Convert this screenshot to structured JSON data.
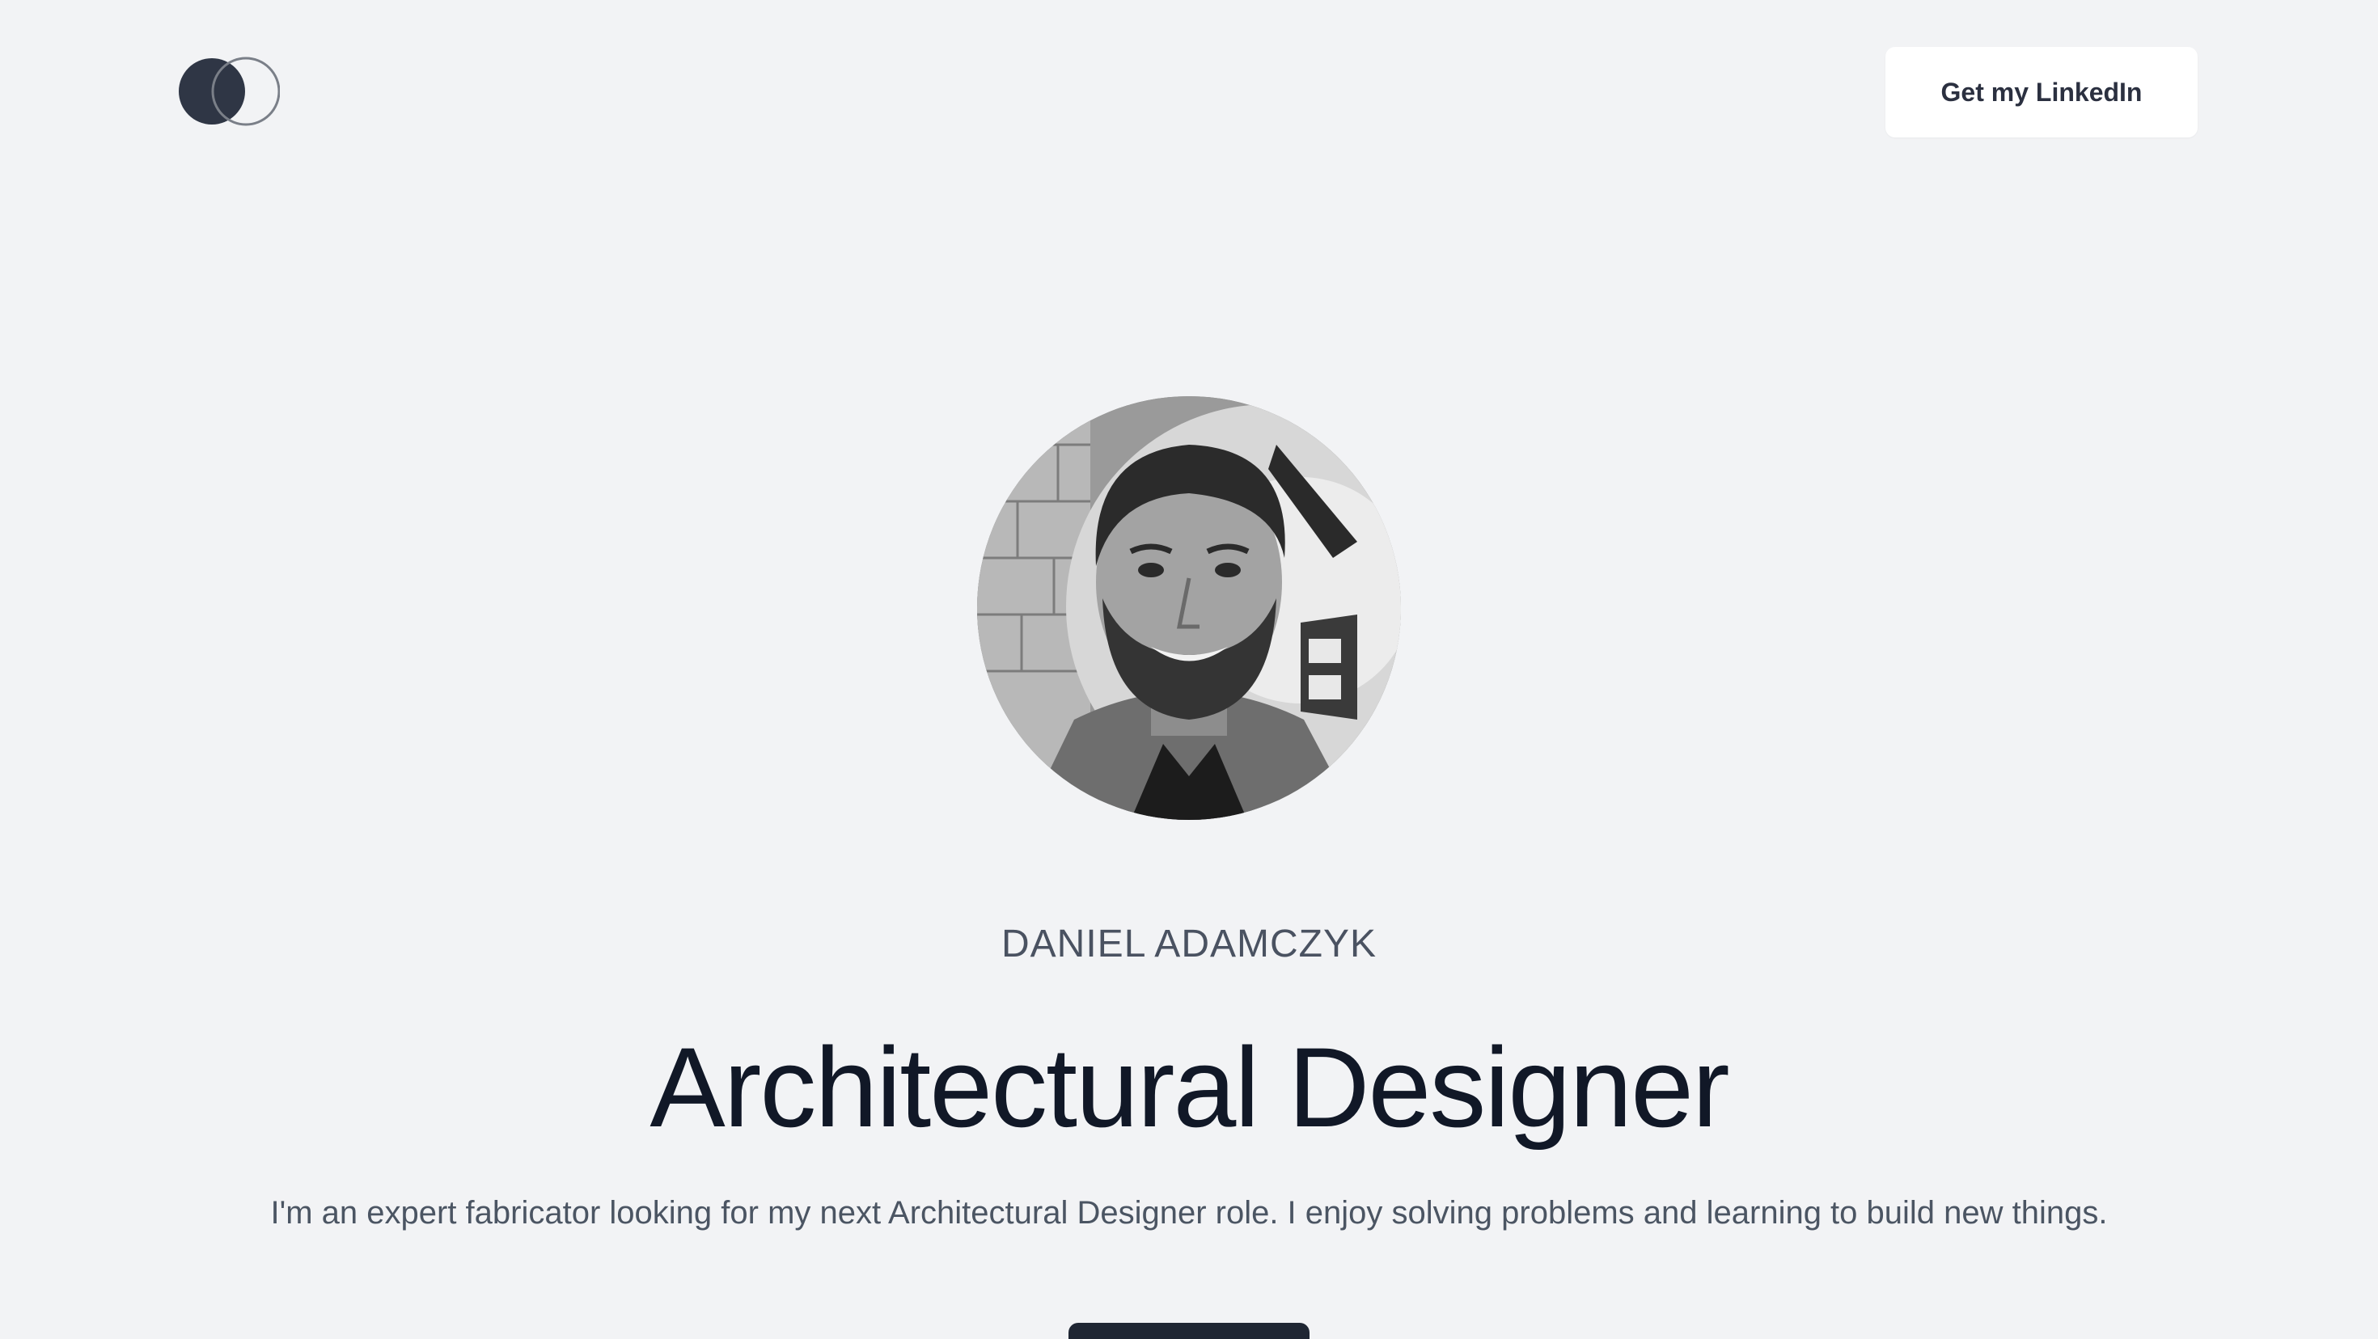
{
  "header": {
    "logo_icon": "overlapping-circles-logo",
    "linkedin_button_label": "Get my LinkedIn"
  },
  "hero": {
    "avatar_icon": "profile-photo",
    "name": "DANIEL ADAMCZYK",
    "title": "Architectural Designer",
    "description": "I'm an expert fabricator looking for my next Architectural Designer role. I enjoy solving problems and learning to build new things."
  },
  "colors": {
    "background": "#f2f3f5",
    "title_text": "#111827",
    "body_text": "#4b5563",
    "logo_fill": "#2f3645",
    "button_bg": "#ffffff",
    "cta_bg": "#1f2633"
  }
}
